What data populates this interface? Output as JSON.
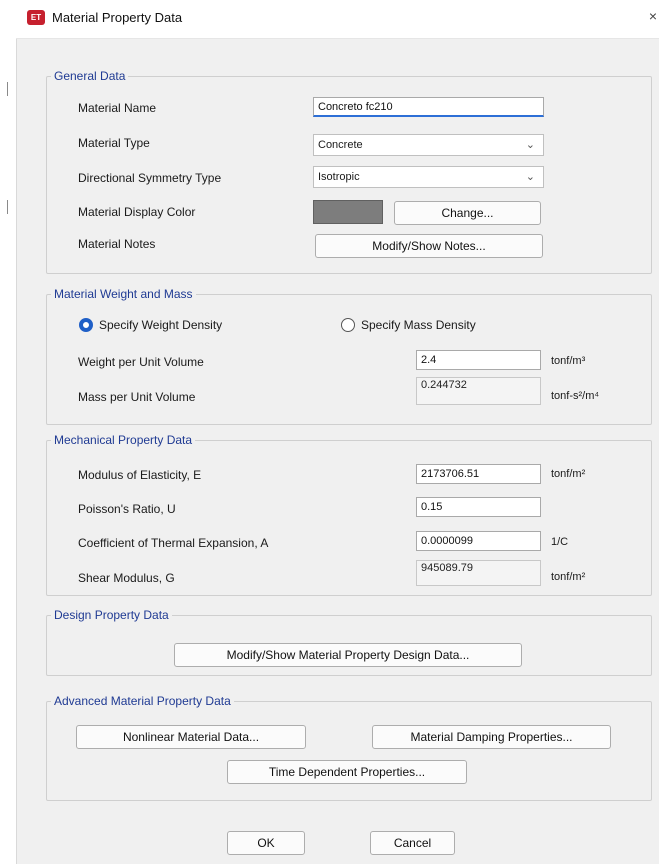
{
  "window": {
    "title": "Material Property Data",
    "icon_text": "ET",
    "close_glyph": "×"
  },
  "general": {
    "legend": "General Data",
    "material_name_label": "Material Name",
    "material_name_value": "Concreto fc210",
    "material_type_label": "Material Type",
    "material_type_value": "Concrete",
    "symmetry_label": "Directional Symmetry Type",
    "symmetry_value": "Isotropic",
    "display_color_label": "Material Display Color",
    "display_color": "#7d7d7d",
    "change_label": "Change...",
    "notes_label": "Material Notes",
    "notes_button": "Modify/Show Notes..."
  },
  "weight_mass": {
    "legend": "Material Weight and Mass",
    "radio_weight": "Specify Weight Density",
    "radio_mass": "Specify Mass Density",
    "selected": "weight",
    "weight_label": "Weight per Unit Volume",
    "weight_value": "2.4",
    "weight_unit": "tonf/m³",
    "mass_label": "Mass per Unit Volume",
    "mass_value": "0.244732",
    "mass_unit": "tonf-s²/m⁴"
  },
  "mechanical": {
    "legend": "Mechanical Property Data",
    "modulus_label": "Modulus of Elasticity,  E",
    "modulus_value": "2173706.51",
    "modulus_unit": "tonf/m²",
    "poisson_label": "Poisson's Ratio,  U",
    "poisson_value": "0.15",
    "thermal_label": "Coefficient of Thermal Expansion,  A",
    "thermal_value": "0.0000099",
    "thermal_unit": "1/C",
    "shear_label": "Shear Modulus,  G",
    "shear_value": "945089.79",
    "shear_unit": "tonf/m²"
  },
  "design": {
    "legend": "Design Property Data",
    "button": "Modify/Show Material Property Design Data..."
  },
  "advanced": {
    "legend": "Advanced Material Property Data",
    "nonlinear_button": "Nonlinear Material Data...",
    "damping_button": "Material Damping Properties...",
    "time_dependent_button": "Time Dependent Properties..."
  },
  "footer": {
    "ok": "OK",
    "cancel": "Cancel"
  },
  "colors": {
    "accent": "#1f5fc7",
    "legend_text": "#1f3a93",
    "brand_icon": "#c6202e",
    "dialog_bg": "#f0f0f0"
  }
}
